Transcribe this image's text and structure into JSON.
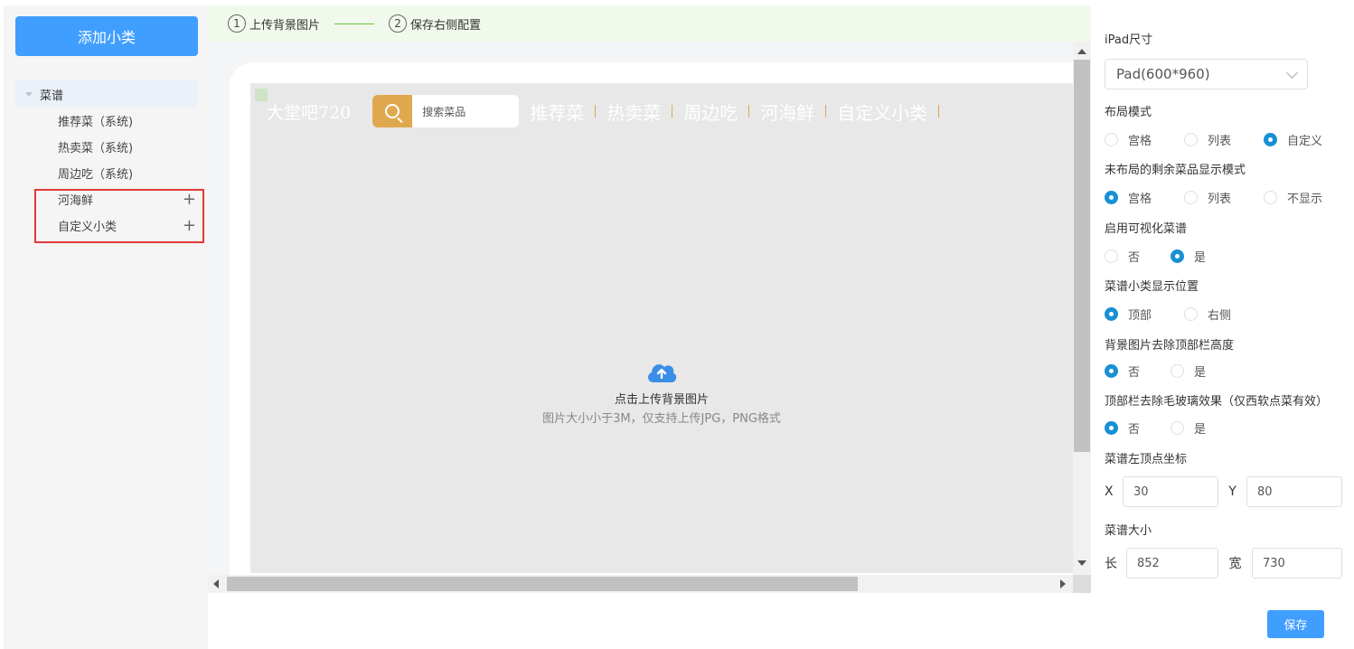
{
  "sidebar": {
    "add_button": "添加小类",
    "tree_root": "菜谱",
    "items": [
      {
        "label": "推荐菜（系统)"
      },
      {
        "label": "热卖菜（系统)"
      },
      {
        "label": "周边吃（系统)"
      },
      {
        "label": "河海鲜",
        "has_add": true
      },
      {
        "label": "自定义小类",
        "has_add": true
      }
    ],
    "plus_glyph": "+"
  },
  "steps": [
    {
      "num": "1",
      "label": "上传背景图片"
    },
    {
      "num": "2",
      "label": "保存右侧配置"
    }
  ],
  "preview": {
    "store_name": "大堂吧720",
    "search_placeholder": "搜索菜品",
    "categories": [
      "推荐菜",
      "热卖菜",
      "周边吃",
      "河海鲜",
      "自定义小类"
    ],
    "upload_title": "点击上传背景图片",
    "upload_tip": "图片大小小于3M，仅支持上传JPG，PNG格式"
  },
  "settings": {
    "ipad_size_label": "iPad尺寸",
    "ipad_size_value": "Pad(600*960)",
    "layout_mode_label": "布局模式",
    "layout_mode_options": [
      "宫格",
      "列表",
      "自定义"
    ],
    "layout_mode_selected": "自定义",
    "remaining_label": "未布局的剩余菜品显示模式",
    "remaining_options": [
      "宫格",
      "列表",
      "不显示"
    ],
    "remaining_selected": "宫格",
    "visual_menu_label": "启用可视化菜谱",
    "visual_menu_options": [
      "否",
      "是"
    ],
    "visual_menu_selected": "是",
    "category_pos_label": "菜谱小类显示位置",
    "category_pos_options": [
      "顶部",
      "右侧"
    ],
    "category_pos_selected": "顶部",
    "bg_remove_top_label": "背景图片去除顶部栏高度",
    "bg_remove_top_options": [
      "否",
      "是"
    ],
    "bg_remove_top_selected": "否",
    "topbar_glass_label": "顶部栏去除毛玻璃效果（仅西软点菜有效）",
    "topbar_glass_options": [
      "否",
      "是"
    ],
    "topbar_glass_selected": "否",
    "menu_origin_label": "菜谱左顶点坐标",
    "x_label": "X",
    "x_value": "30",
    "y_label": "Y",
    "y_value": "80",
    "menu_size_label": "菜谱大小",
    "length_label": "长",
    "length_value": "852",
    "width_label": "宽",
    "width_value": "730",
    "save_button": "保存"
  },
  "colors": {
    "primary": "#409eff",
    "radio_selected": "#1890d4",
    "step_line": "#67c23a",
    "search_accent": "#e0a84e",
    "highlight_border": "#e53935"
  }
}
